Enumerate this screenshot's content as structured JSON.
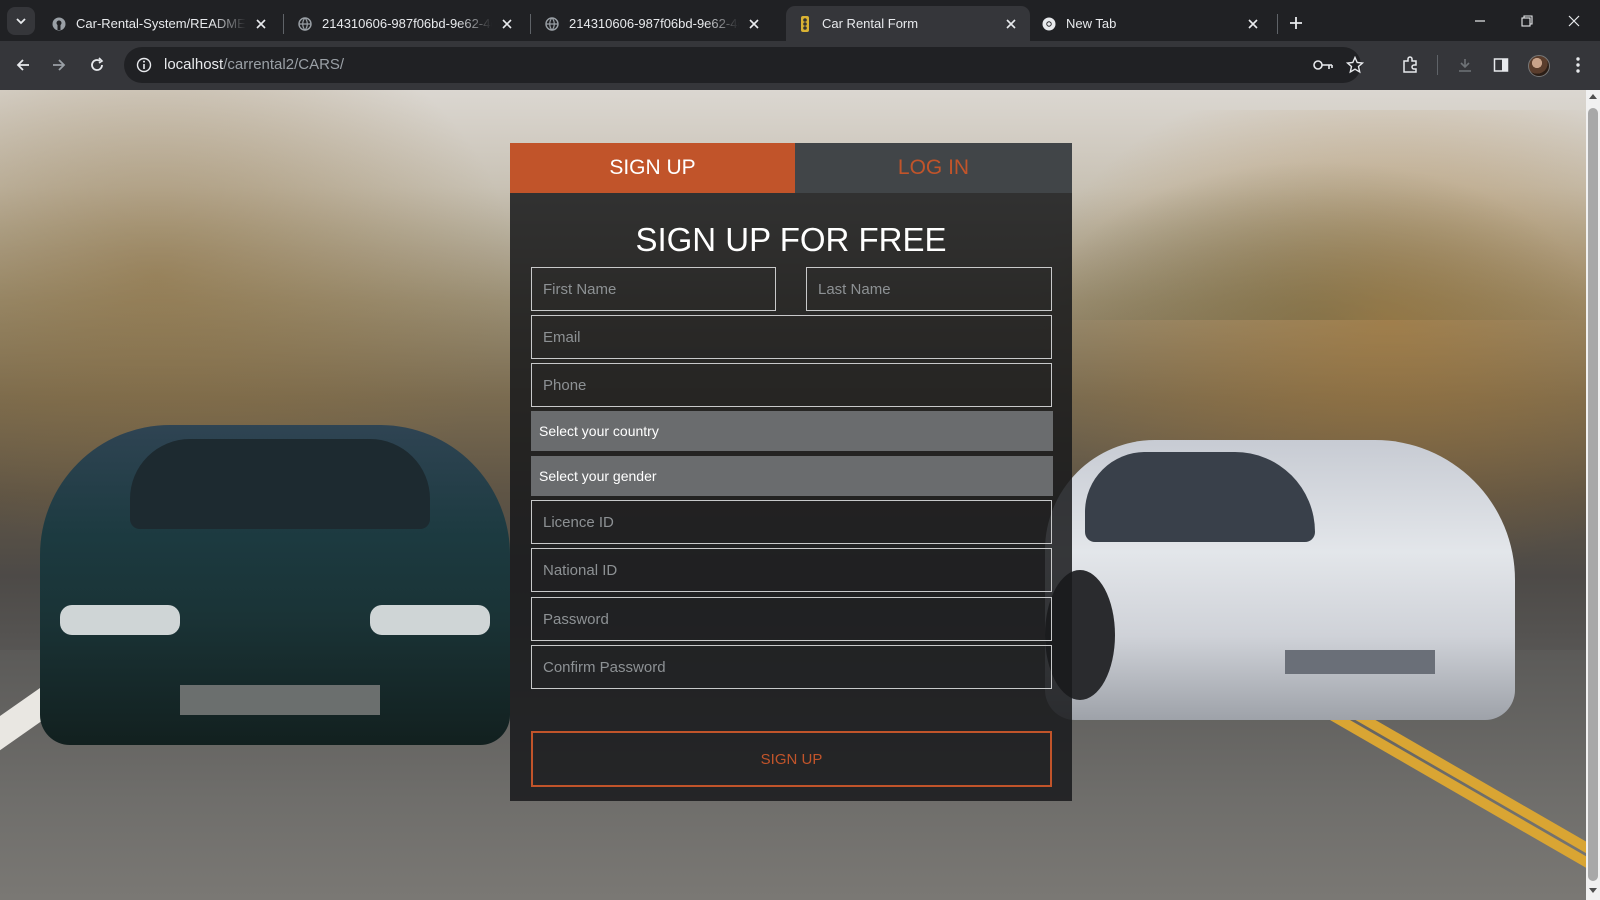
{
  "browser": {
    "tabs": [
      {
        "label": "Car-Rental-System/README.md",
        "icon": "github-icon",
        "active": false
      },
      {
        "label": "214310606-987f06bd-9e62-4d8",
        "icon": "globe-icon",
        "active": false
      },
      {
        "label": "214310606-987f06bd-9e62-4d8",
        "icon": "globe-icon",
        "active": false
      },
      {
        "label": "Car Rental Form",
        "icon": "traffic-light-icon",
        "active": true
      },
      {
        "label": "New Tab",
        "icon": "chrome-icon",
        "active": false
      }
    ],
    "address": {
      "host": "localhost",
      "path": "/carrental2/CARS/"
    }
  },
  "form": {
    "tabs": {
      "signup": "SIGN UP",
      "login": "LOG IN"
    },
    "title": "SIGN UP FOR FREE",
    "placeholders": {
      "first_name": "First Name",
      "last_name": "Last Name",
      "email": "Email",
      "phone": "Phone",
      "licence_id": "Licence ID",
      "national_id": "National ID",
      "password": "Password",
      "confirm_password": "Confirm Password"
    },
    "selects": {
      "country": "Select your country",
      "gender": "Select your gender"
    },
    "submit_label": "SIGN UP"
  },
  "colors": {
    "accent": "#c1542a",
    "login_tab_bg": "#414548",
    "card_bg": "#181a1c"
  }
}
